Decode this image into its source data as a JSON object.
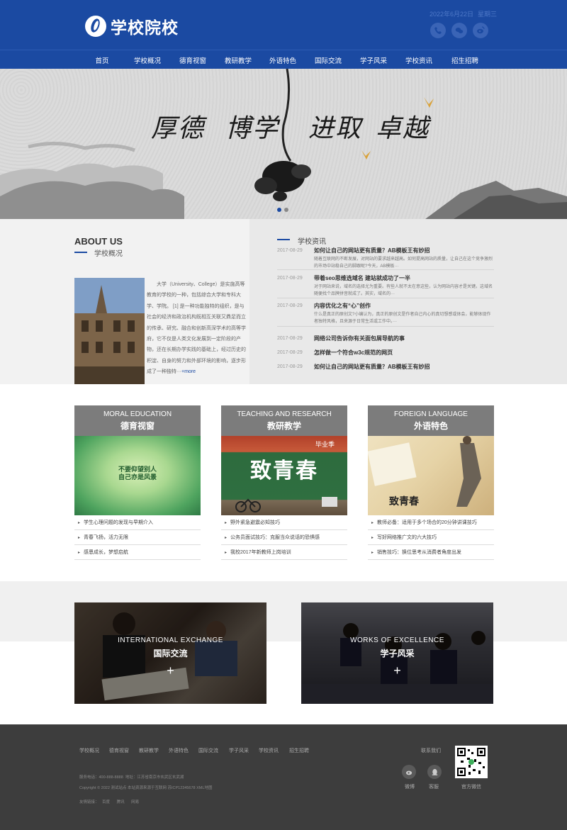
{
  "header": {
    "logo_text": "学校院校",
    "date_text": "2022年6月22日",
    "weekday_text": "星期三",
    "bg_color": "#1b4aa2",
    "social_icons": [
      "phone-icon",
      "wechat-icon",
      "weibo-icon"
    ]
  },
  "nav": {
    "items": [
      "首页",
      "学校概况",
      "德育视窗",
      "教研教学",
      "外语特色",
      "国际交流",
      "学子风采",
      "学校资讯",
      "招生招聘"
    ]
  },
  "banner": {
    "motto": [
      "厚德",
      "博学",
      "进取",
      "卓越"
    ],
    "slide_count": 2,
    "active_slide": 1
  },
  "about": {
    "title": "ABOUT US",
    "subtitle": "学校概况",
    "text": "大学（University、College）是实施高等教育的学校的一种，包括综合大学和专科大学、学院。 [1] 是一种功能独特的组织，是与社会的经济和政治机构既相互关联又鼎足而立的传承、研究、融合和创新高深学术的高等学府，它不仅是人类文化发展到一定阶段的产物，还在长期办学实践的基础上，经过历史的积淀、自身的努力和外部环境的影响，逐步形成了一种独特···",
    "more": "+more"
  },
  "news": {
    "title": "学校资讯",
    "items": [
      {
        "date": "2017-08-29",
        "title": "如何让自己的网站更有质量？AB模板王有妙招",
        "desc": "随着互联网的不断发展，对网站的要求越来越高。如何提高网站的质量，让自己在这个竞争激烈的市场中站稳自己的脚跟呢?今天，AB模板···"
      },
      {
        "date": "2017-08-29",
        "title": "带着seo思维选域名 建站就成功了一半",
        "desc": "对于网站来说，域名的选择尤为重要。有些人就不太在意这些，认为网站内容才是关键。这域名随便找个品牌拼音就成了。其实，域名的···"
      },
      {
        "date": "2017-08-29",
        "title": "内容优化之有“心”创作",
        "desc": "什么是真正的原创文?小编认为，真正的原创文是作者自己内心的真切想感或体会，能够体现作者独特风格，且来源于日常生活或工作中。···"
      },
      {
        "date": "2017-08-29",
        "title": "网络公司告诉你有关面包屑导航的事",
        "desc": ""
      },
      {
        "date": "2017-08-29",
        "title": "怎样做一个符合w3c规范的网页",
        "desc": ""
      },
      {
        "date": "2017-08-29",
        "title": "如何让自己的网站更有质量？AB模板王有妙招",
        "desc": ""
      }
    ]
  },
  "cards": [
    {
      "en": "MORAL EDUCATION",
      "cn": "德育视窗",
      "image_text": [
        "不要仰望别人",
        "自己亦是风景"
      ],
      "items": [
        "学生心理问题的发现与早期介入",
        "青春飞扬，活力无限",
        "感恩成长，梦想启航"
      ]
    },
    {
      "en": "TEACHING AND RESEARCH",
      "cn": "教研教学",
      "image_text": [
        "毕业季",
        "致青春"
      ],
      "items": [
        "野外紧急避震必知技巧",
        "公务员面试技巧：克服当众说话的恐惧感",
        "我校2017年新教师上岗培训"
      ]
    },
    {
      "en": "FOREIGN LANGUAGE",
      "cn": "外语特色",
      "image_text": [
        "致青春"
      ],
      "items": [
        "教师必备：适用于多个场合的20分钟讲课技巧",
        "写好网络推广文的六大技巧",
        "销售技巧：换位思考从消费者角度出发"
      ]
    }
  ],
  "photos": [
    {
      "en": "INTERNATIONAL EXCHANGE",
      "cn": "国际交流",
      "plus": "+"
    },
    {
      "en": "WORKS OF EXCELLENCE",
      "cn": "学子风采",
      "plus": "+"
    }
  ],
  "footer": {
    "nav": [
      "学校概况",
      "德育视窗",
      "教研教学",
      "外语特色",
      "国际交流",
      "学子风采",
      "学校资讯",
      "招生招聘"
    ],
    "phone": "服务电话：400-888-8888",
    "address": "地址：江苏省南京市玄武区玄武湖",
    "copyright": "Copyright © 2022 测试站点 本站资源来源于互联网   苏ICP12345678   XML地图",
    "links_label": "友情链接：",
    "links": [
      "百度",
      "腾讯",
      "网易"
    ],
    "contact_label": "联系我们",
    "weibo_label": "微博",
    "qq_label": "客服",
    "qr_label": "官方微信"
  }
}
